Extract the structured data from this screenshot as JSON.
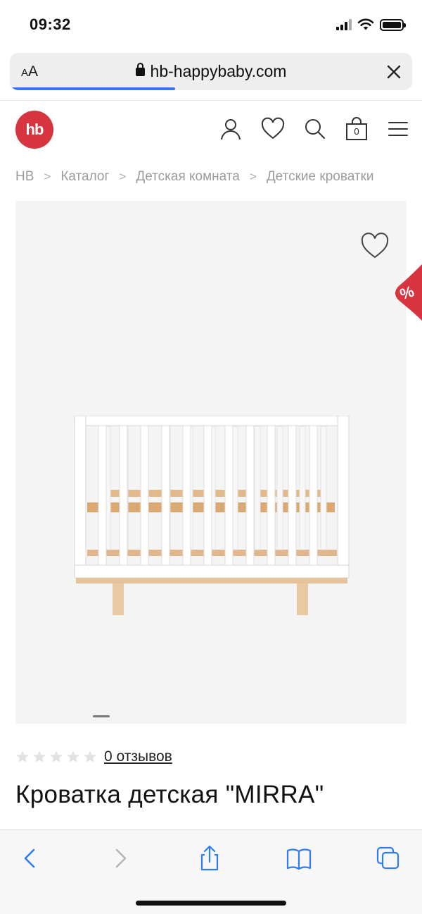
{
  "status": {
    "time": "09:32"
  },
  "browser": {
    "text_size_label_small": "A",
    "text_size_label_large": "A",
    "url": "hb-happybaby.com",
    "load_progress": 0.41
  },
  "site": {
    "logo_text": "hb",
    "brand_color": "#d6343f",
    "cart_count": "0",
    "header_icons": [
      "account-icon",
      "wishlist-icon",
      "search-icon",
      "cart-icon",
      "menu-icon"
    ]
  },
  "breadcrumb": [
    "HB",
    "Каталог",
    "Детская комната",
    "Детские кроватки"
  ],
  "product": {
    "sale_badge": "%",
    "rating_stars": 0,
    "rating_max": 5,
    "reviews_link": "0 отзывов",
    "title": "Кроватка детская \"MIRRA\""
  },
  "toolbar": {
    "buttons": [
      "back-icon",
      "forward-icon",
      "share-icon",
      "bookmarks-icon",
      "tabs-icon"
    ]
  }
}
